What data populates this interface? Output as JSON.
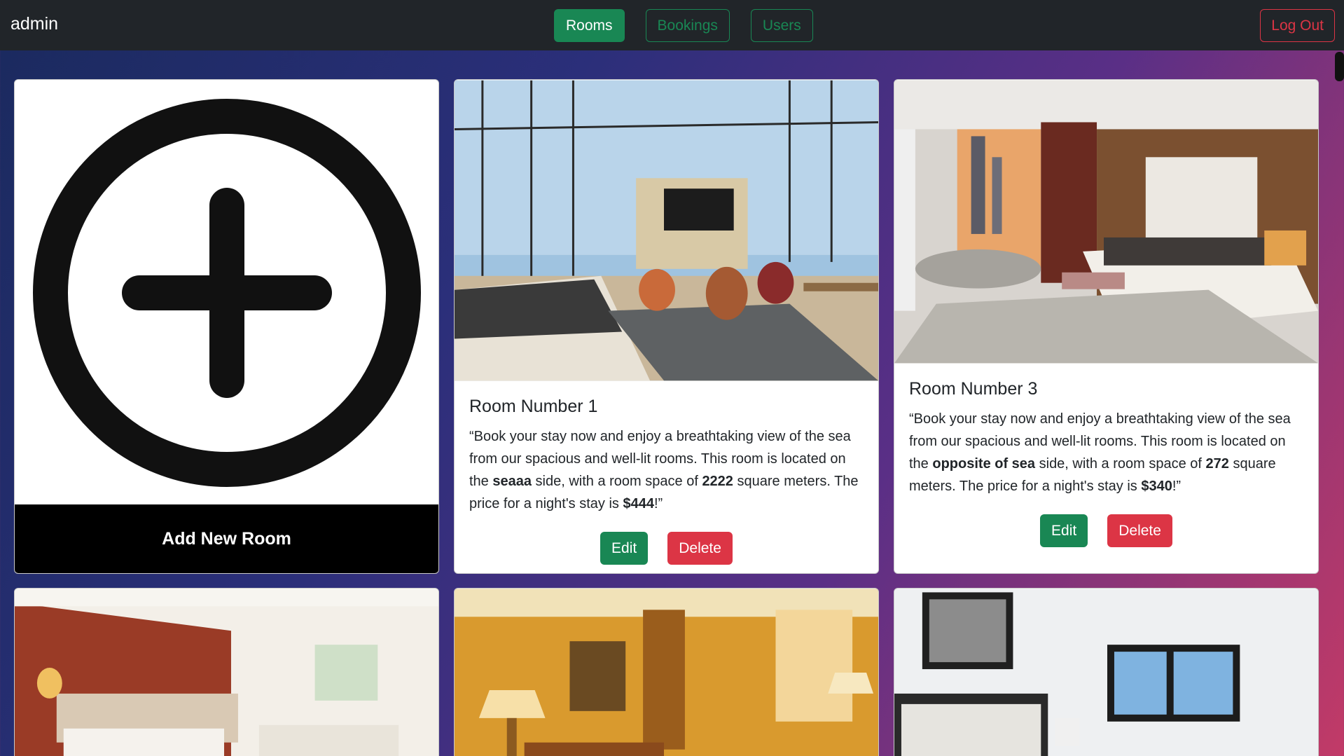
{
  "navbar": {
    "brand": "admin",
    "tabs": [
      "Rooms",
      "Bookings",
      "Users"
    ],
    "logout_label": "Log Out"
  },
  "add_card": {
    "label": "Add New Room"
  },
  "rooms": [
    {
      "title": "Room Number 1",
      "desc_pre": "“Book your stay now and enjoy a breathtaking view of the sea from our spacious and well-lit rooms. This room is located on the ",
      "side": "seaaa",
      "desc_mid": " side, with a room space of ",
      "space": "2222",
      "desc_mid2": " square meters. The price for a night's stay is ",
      "price": "$444",
      "desc_end": "!”",
      "edit_label": "Edit",
      "delete_label": "Delete"
    },
    {
      "title": "Room Number 3",
      "desc_pre": "“Book your stay now and enjoy a breathtaking view of the sea from our spacious and well-lit rooms. This room is located on the ",
      "side": "opposite of sea",
      "desc_mid": " side, with a room space of ",
      "space": "272",
      "desc_mid2": " square meters. The price for a night's stay is ",
      "price": "$340",
      "desc_end": "!”",
      "edit_label": "Edit",
      "delete_label": "Delete"
    }
  ],
  "colors": {
    "navbar_bg": "#212529",
    "success": "#198754",
    "danger": "#dc3545"
  }
}
